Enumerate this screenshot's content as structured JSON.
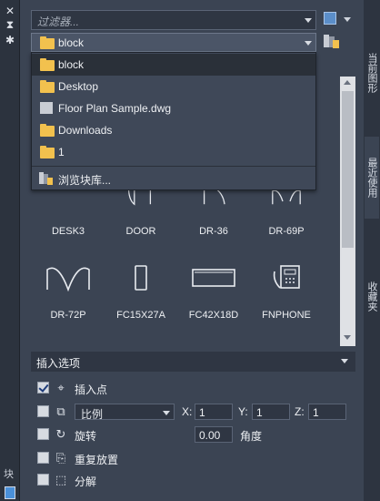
{
  "filter": {
    "placeholder": "过滤器..."
  },
  "path": {
    "current": "block"
  },
  "dropdown": {
    "items": [
      {
        "label": "block",
        "kind": "folder"
      },
      {
        "label": "Desktop",
        "kind": "folder"
      },
      {
        "label": "Floor Plan Sample.dwg",
        "kind": "file"
      },
      {
        "label": "Downloads",
        "kind": "folder"
      },
      {
        "label": "1",
        "kind": "folder"
      }
    ],
    "browse_label": "浏览块库..."
  },
  "gallery": {
    "row1": [
      "DESK3",
      "DOOR",
      "DR-36",
      "DR-69P"
    ],
    "row2": [
      "DR-72P",
      "FC15X27A",
      "FC42X18D",
      "FNPHONE"
    ]
  },
  "insert_options": {
    "header": "插入选项",
    "insertion_point": {
      "label": "插入点",
      "checked": true
    },
    "scale": {
      "mode": "比例",
      "x_label": "X:",
      "x": "1",
      "y_label": "Y:",
      "y": "1",
      "z_label": "Z:",
      "z": "1",
      "checked": false
    },
    "rotation": {
      "label": "旋转",
      "angle": "0.00",
      "angle_label": "角度",
      "checked": false
    },
    "repeat_placement": {
      "label": "重复放置",
      "checked": false
    },
    "explode": {
      "label": "分解",
      "checked": false
    }
  },
  "left_rail": {
    "side_text": "块"
  },
  "right_rail": {
    "tabs": [
      "当前图形",
      "最近使用",
      "收藏夹"
    ]
  },
  "colors": {
    "panel_bg": "#3b4453",
    "folder": "#f2c14e",
    "accent": "#4a90d9"
  }
}
